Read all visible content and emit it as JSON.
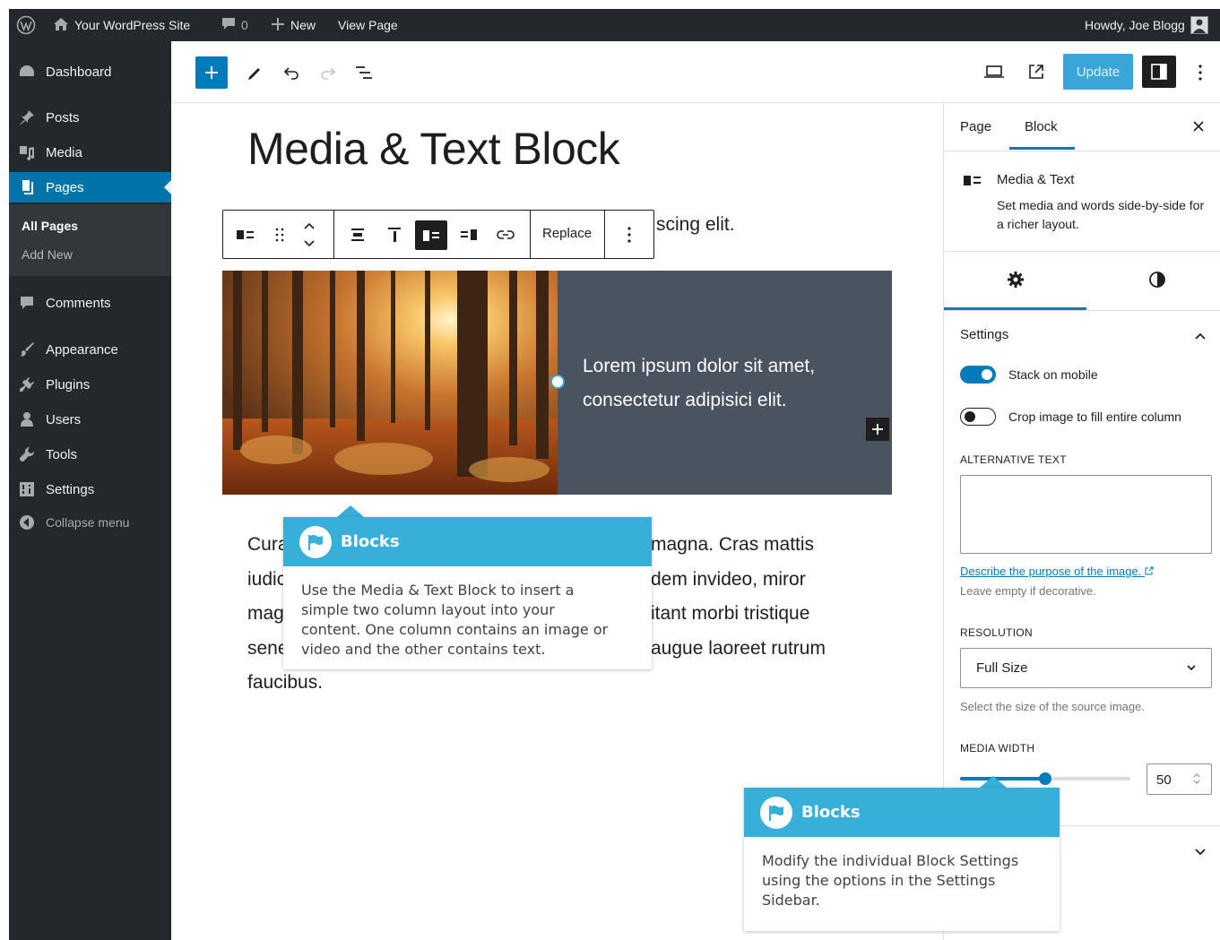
{
  "admin_bar": {
    "site_name": "Your WordPress Site",
    "comments_count": "0",
    "new_label": "New",
    "view_page_label": "View Page",
    "howdy": "Howdy, Joe Blogg"
  },
  "sidebar": {
    "items": [
      {
        "label": "Dashboard",
        "icon": "dashboard-icon"
      },
      {
        "label": "Posts",
        "icon": "pin-icon"
      },
      {
        "label": "Media",
        "icon": "media-icon"
      },
      {
        "label": "Pages",
        "icon": "pages-icon"
      },
      {
        "label": "Comments",
        "icon": "comment-icon"
      },
      {
        "label": "Appearance",
        "icon": "brush-icon"
      },
      {
        "label": "Plugins",
        "icon": "plug-icon"
      },
      {
        "label": "Users",
        "icon": "user-icon"
      },
      {
        "label": "Tools",
        "icon": "wrench-icon"
      },
      {
        "label": "Settings",
        "icon": "settings-icon"
      },
      {
        "label": "Collapse menu",
        "icon": "collapse-icon"
      }
    ],
    "submenu": [
      "All Pages",
      "Add New"
    ]
  },
  "toolbar": {
    "update_label": "Update"
  },
  "editor": {
    "page_title": "Media & Text Block",
    "intro_fragment": "scing elit.",
    "replace_label": "Replace",
    "media_text_paragraph": "Lorem ipsum dolor sit amet, consectetur adipisici elit.",
    "body_lines": [
      "Cura",
      "iudic",
      "mag",
      "sene",
      "faucibus."
    ],
    "body_right_lines": [
      "magna. Cras mattis",
      "dem invideo, miror",
      "itant morbi tristique",
      "augue laoreet rutrum"
    ]
  },
  "settings_sidebar": {
    "tab_page": "Page",
    "tab_block": "Block",
    "block_name": "Media & Text",
    "block_description": "Set media and words side-by-side for a richer layout.",
    "section_title": "Settings",
    "stack_on_mobile_label": "Stack on mobile",
    "stack_on_mobile": true,
    "crop_label": "Crop image to fill entire column",
    "crop_enabled": false,
    "alt_text_label": "ALTERNATIVE TEXT",
    "alt_text_value": "",
    "describe_link": "Describe the purpose of the image.",
    "leave_empty_help": "Leave empty if decorative.",
    "resolution_label": "RESOLUTION",
    "resolution_value": "Full Size",
    "resolution_help": "Select the size of the source image.",
    "media_width_label": "MEDIA WIDTH",
    "media_width_value": "50",
    "media_width_fraction": 0.5
  },
  "callouts": [
    {
      "title": "Blocks",
      "body_lines": [
        "Use the Media & Text Block to insert a",
        "simple two column layout into your",
        "content. One column contains an image or",
        "video and the other contains text."
      ]
    },
    {
      "title": "Blocks",
      "body_lines": [
        "Modify the individual Block Settings",
        "using the options in the Settings",
        "Sidebar."
      ]
    }
  ],
  "colors": {
    "admin_bar": "#23282d",
    "accent": "#007cba",
    "callout": "#38afd9",
    "media_text_bg": "#4a5360"
  }
}
